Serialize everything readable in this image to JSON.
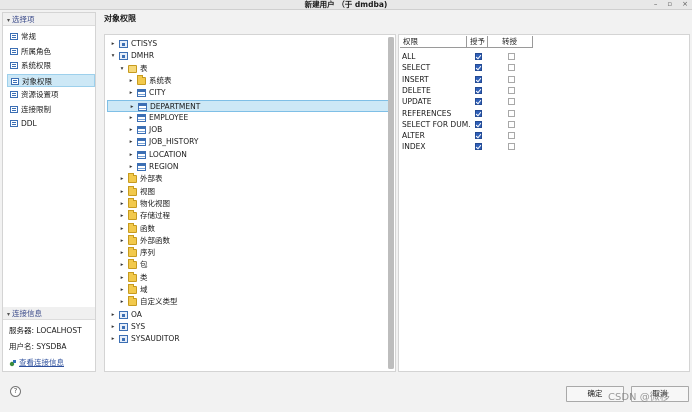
{
  "window": {
    "title": "新建用户 （于 dmdba)",
    "controls": [
      "–",
      "▫",
      "×"
    ]
  },
  "left": {
    "select_header": "选择项",
    "nav_items": [
      {
        "label": "常规",
        "icon": "form-icon"
      },
      {
        "label": "所属角色",
        "icon": "form-icon"
      },
      {
        "label": "系统权限",
        "icon": "form-icon"
      },
      {
        "label": "对象权限",
        "icon": "form-icon",
        "selected": true
      },
      {
        "label": "资源设置项",
        "icon": "form-icon"
      },
      {
        "label": "连接限制",
        "icon": "form-icon"
      },
      {
        "label": "DDL",
        "icon": "form-icon"
      }
    ],
    "conn_header": "连接信息",
    "server": "服务器: LOCALHOST",
    "user": "用户名: SYSDBA",
    "conn_link": "查看连接信息"
  },
  "main": {
    "heading": "对象权限"
  },
  "tree": [
    {
      "label": "CTISYS",
      "twisty": "▸",
      "icon": "schema",
      "depth": 0
    },
    {
      "label": "DMHR",
      "twisty": "▾",
      "icon": "schema",
      "depth": 0
    },
    {
      "label": "表",
      "twisty": "▾",
      "icon": "folder-open",
      "depth": 1
    },
    {
      "label": "系统表",
      "twisty": "▸",
      "icon": "folder",
      "depth": 2
    },
    {
      "label": "CITY",
      "twisty": "▸",
      "icon": "table",
      "depth": 2
    },
    {
      "label": "DEPARTMENT",
      "twisty": "▸",
      "icon": "table",
      "depth": 2,
      "selected": true
    },
    {
      "label": "EMPLOYEE",
      "twisty": "▸",
      "icon": "table",
      "depth": 2
    },
    {
      "label": "JOB",
      "twisty": "▸",
      "icon": "table",
      "depth": 2
    },
    {
      "label": "JOB_HISTORY",
      "twisty": "▸",
      "icon": "table",
      "depth": 2
    },
    {
      "label": "LOCATION",
      "twisty": "▸",
      "icon": "table",
      "depth": 2
    },
    {
      "label": "REGION",
      "twisty": "▸",
      "icon": "table",
      "depth": 2
    },
    {
      "label": "外部表",
      "twisty": "▸",
      "icon": "folder",
      "depth": 1
    },
    {
      "label": "视图",
      "twisty": "▸",
      "icon": "folder",
      "depth": 1
    },
    {
      "label": "物化视图",
      "twisty": "▸",
      "icon": "folder",
      "depth": 1
    },
    {
      "label": "存储过程",
      "twisty": "▸",
      "icon": "folder",
      "depth": 1
    },
    {
      "label": "函数",
      "twisty": "▸",
      "icon": "folder",
      "depth": 1
    },
    {
      "label": "外部函数",
      "twisty": "▸",
      "icon": "folder",
      "depth": 1
    },
    {
      "label": "序列",
      "twisty": "▸",
      "icon": "folder",
      "depth": 1
    },
    {
      "label": "包",
      "twisty": "▸",
      "icon": "folder",
      "depth": 1
    },
    {
      "label": "类",
      "twisty": "▸",
      "icon": "folder",
      "depth": 1
    },
    {
      "label": "域",
      "twisty": "▸",
      "icon": "folder",
      "depth": 1
    },
    {
      "label": "自定义类型",
      "twisty": "▸",
      "icon": "folder",
      "depth": 1
    },
    {
      "label": "OA",
      "twisty": "▸",
      "icon": "schema",
      "depth": 0
    },
    {
      "label": "SYS",
      "twisty": "▸",
      "icon": "schema",
      "depth": 0
    },
    {
      "label": "SYSAUDITOR",
      "twisty": "▸",
      "icon": "schema",
      "depth": 0
    }
  ],
  "grid": {
    "headers": [
      "权限",
      "授予",
      "转授"
    ],
    "rows": [
      {
        "name": "ALL",
        "grant": true,
        "regrant": false
      },
      {
        "name": "SELECT",
        "grant": true,
        "regrant": false
      },
      {
        "name": "INSERT",
        "grant": true,
        "regrant": false
      },
      {
        "name": "DELETE",
        "grant": true,
        "regrant": false
      },
      {
        "name": "UPDATE",
        "grant": true,
        "regrant": false
      },
      {
        "name": "REFERENCES",
        "grant": true,
        "regrant": false
      },
      {
        "name": "SELECT FOR DUM.",
        "grant": true,
        "regrant": false
      },
      {
        "name": "ALTER",
        "grant": true,
        "regrant": false
      },
      {
        "name": "INDEX",
        "grant": true,
        "regrant": false
      }
    ]
  },
  "footer": {
    "help": "?",
    "ok": "确定",
    "cancel": "取消",
    "watermark": "CSDN @微移"
  }
}
